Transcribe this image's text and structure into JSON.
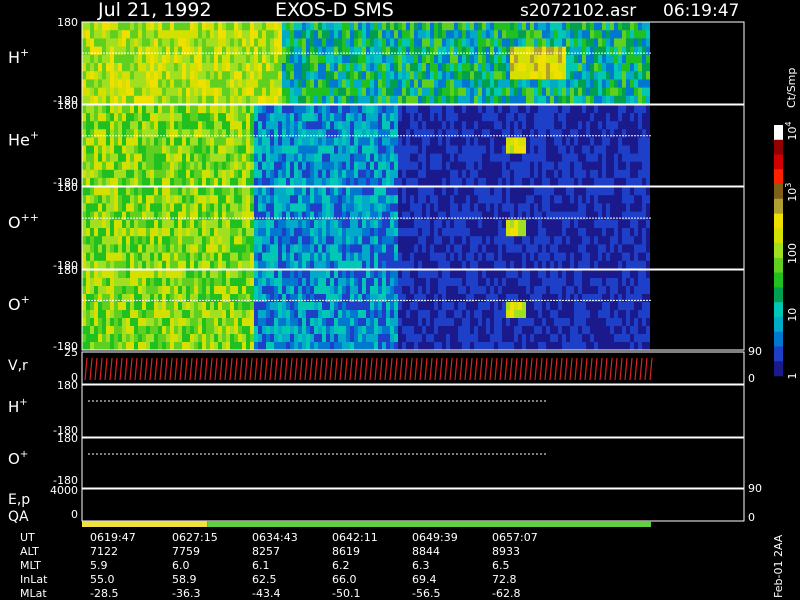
{
  "header": {
    "date": "Jul 21, 1992",
    "instrument": "EXOS-D SMS",
    "filename": "s2072102.asr",
    "time": "06:19:47"
  },
  "colorbar": {
    "unit": "Ct/Smp",
    "ticks": [
      {
        "label": "1",
        "value": 1
      },
      {
        "label": "10",
        "value": 10
      },
      {
        "label": "100",
        "value": 100
      },
      {
        "label": "10",
        "sup": "3",
        "value": 1000
      },
      {
        "label": "10",
        "sup": "4",
        "value": 10000
      }
    ],
    "colors": [
      "#1a1a8c",
      "#1e40c8",
      "#0078d0",
      "#00aac8",
      "#00c8b4",
      "#00a050",
      "#20c020",
      "#60d020",
      "#a0e020",
      "#d4e000",
      "#f0e000",
      "#b0a030",
      "#806018",
      "#ff2000",
      "#d00000",
      "#900000",
      "#ffffff"
    ]
  },
  "panels": {
    "spectrograms": [
      {
        "name": "H+",
        "base": "H",
        "sup": "+",
        "ymin": "-180",
        "ymax": "180"
      },
      {
        "name": "He+",
        "base": "He",
        "sup": "+",
        "ymin": "-180",
        "ymax": "180"
      },
      {
        "name": "O++",
        "base": "O",
        "sup": "++",
        "ymin": "-180",
        "ymax": "180"
      },
      {
        "name": "O+",
        "base": "O",
        "sup": "+",
        "ymin": "-180",
        "ymax": "180"
      }
    ],
    "vr": {
      "label": "V,r",
      "ytop": "25",
      "ybot": "0",
      "rtop": "90",
      "rbot": "0"
    },
    "h_line": {
      "base": "H",
      "sup": "+",
      "ymin": "-180",
      "ymax": "180"
    },
    "o_line": {
      "base": "O",
      "sup": "+",
      "ymin": "-180",
      "ymax": "180"
    },
    "ep": {
      "label1": "E,p",
      "label2": "QA",
      "ytop": "4000",
      "ybot": "0",
      "rtop": "90",
      "rbot": "0"
    },
    "qa_bar": [
      {
        "fraction": 0.22,
        "color": "#f0e040"
      },
      {
        "fraction": 0.78,
        "color": "#60d040"
      }
    ]
  },
  "footer": {
    "rows": [
      {
        "name": "UT",
        "values": [
          "0619:47",
          "0627:15",
          "0634:43",
          "0642:11",
          "0649:39",
          "0657:07"
        ]
      },
      {
        "name": "ALT",
        "values": [
          "7122",
          "7759",
          "8257",
          "8619",
          "8844",
          "8933"
        ]
      },
      {
        "name": "MLT",
        "values": [
          "5.9",
          "6.0",
          "6.1",
          "6.2",
          "6.3",
          "6.5"
        ]
      },
      {
        "name": "InLat",
        "values": [
          "55.0",
          "58.9",
          "62.5",
          "66.0",
          "69.4",
          "72.8"
        ]
      },
      {
        "name": "MLat",
        "values": [
          "-28.5",
          "-36.3",
          "-43.4",
          "-50.1",
          "-56.5",
          "-62.8"
        ]
      }
    ],
    "version": "Feb-01 2AA"
  },
  "chart_data": {
    "type": "heatmap",
    "title": "",
    "data_end_fraction": 0.86,
    "colorbar_range": [
      1,
      10000
    ],
    "panels": [
      "H+",
      "He+",
      "O++",
      "O+"
    ]
  }
}
